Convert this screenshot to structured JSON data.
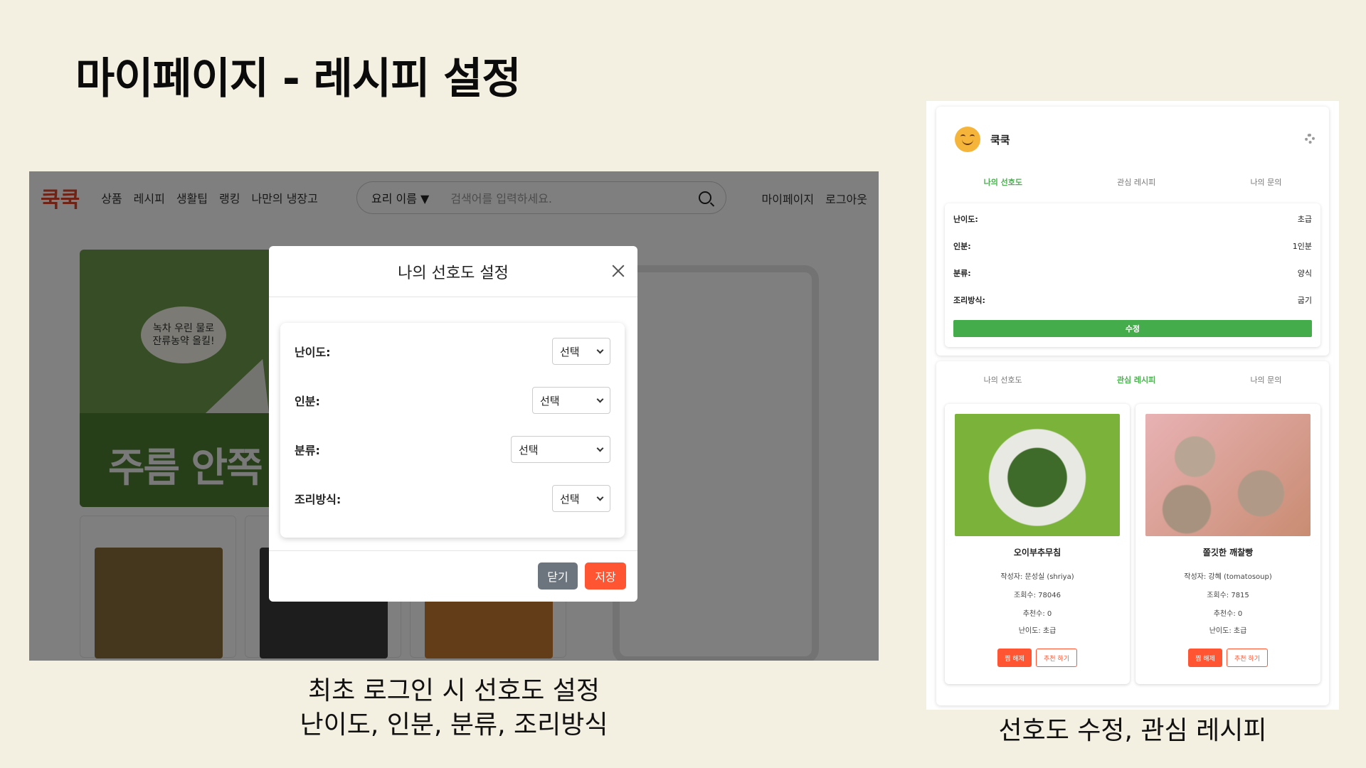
{
  "slide": {
    "title": "마이페이지 - 레시피 설정"
  },
  "site": {
    "logo": "쿡쿡",
    "nav": [
      "상품",
      "레시피",
      "생활팁",
      "랭킹",
      "나만의 냉장고"
    ],
    "search": {
      "category": "요리 이름 ▼",
      "placeholder": "검색어를 입력하세요."
    },
    "right_links": [
      "마이페이지",
      "로그아웃"
    ],
    "banner": {
      "speech": "녹차 우린 물로\n잔류농약 올킬!",
      "headline": "주름 안쪽"
    }
  },
  "modal": {
    "title": "나의 선호도 설정",
    "rows": [
      {
        "label": "난이도:",
        "value": "선택"
      },
      {
        "label": "인분:",
        "value": "선택"
      },
      {
        "label": "분류:",
        "value": "선택"
      },
      {
        "label": "조리방식:",
        "value": "선택"
      }
    ],
    "close_label": "닫기",
    "save_label": "저장"
  },
  "caption_left": {
    "line1": "최초 로그인 시 선호도 설정",
    "line2": "난이도, 인분, 분류, 조리방식"
  },
  "mypage": {
    "username": "쿡쿡",
    "tabs": [
      "나의 선호도",
      "관심 레시피",
      "나의 문의"
    ],
    "prefs": [
      {
        "key": "난이도:",
        "value": "초급"
      },
      {
        "key": "인분:",
        "value": "1인분"
      },
      {
        "key": "분류:",
        "value": "양식"
      },
      {
        "key": "조리방식:",
        "value": "굽기"
      }
    ],
    "edit_label": "수정",
    "recipes": [
      {
        "title": "오이부추무침",
        "author": "작성자: 문성실 (shriya)",
        "views": "조회수: 78046",
        "likes": "추천수: 0",
        "level": "난이도: 초급",
        "btn1": "찜 해제",
        "btn2": "추천 하기"
      },
      {
        "title": "쫄깃한 깨찰빵",
        "author": "작성자: 강혜 (tomatosoup)",
        "views": "조회수: 7815",
        "likes": "추천수: 0",
        "level": "난이도: 초급",
        "btn1": "찜 해제",
        "btn2": "추천 하기"
      }
    ]
  },
  "caption_right": "선호도 수정, 관심 레시피",
  "colors": {
    "background": "#f3efe1",
    "accent_green": "#44ac4a",
    "accent_orange": "#ff5533",
    "logo_red": "#e0442a"
  }
}
